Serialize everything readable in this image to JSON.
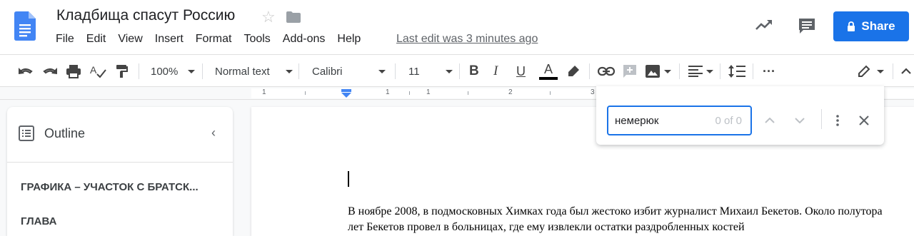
{
  "document": {
    "title": "Кладбища спасут Россию",
    "last_edit": "Last edit was 3 minutes ago"
  },
  "menu": [
    "File",
    "Edit",
    "View",
    "Insert",
    "Format",
    "Tools",
    "Add-ons",
    "Help"
  ],
  "share": {
    "label": "Share"
  },
  "toolbar": {
    "zoom": "100%",
    "style": "Normal text",
    "font": "Calibri",
    "font_size": "11",
    "bold": "B",
    "italic": "I",
    "underline": "U",
    "text_color": "A",
    "more": "···"
  },
  "ruler": {
    "numbers": [
      "1",
      "1",
      "1",
      "2",
      "3"
    ]
  },
  "outline": {
    "title": "Outline",
    "items": [
      "ГРАФИКА – УЧАСТОК С БРАТСК...",
      "ГЛАВА"
    ]
  },
  "body": {
    "paragraph": "В ноябре 2008, в подмосковных Химках года был жестоко избит журналист Михаил Бекетов. Около полутора лет Бекетов провел в больницах, где ему извлекли остатки раздробленных костей"
  },
  "find": {
    "query": "немерюк",
    "count": "0 of 0"
  },
  "colors": {
    "accent": "#1a73e8",
    "text_color_bar": "#000000"
  }
}
